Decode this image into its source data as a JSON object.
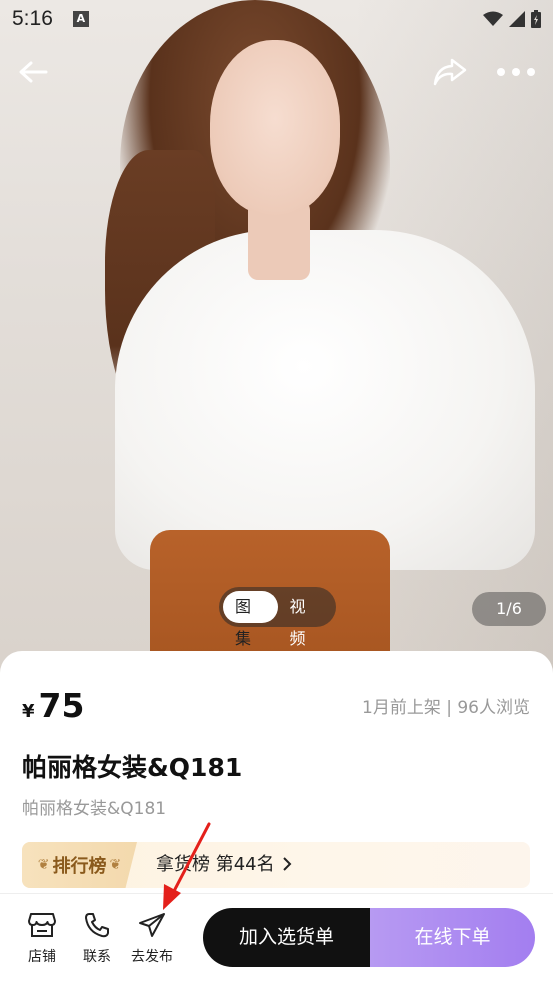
{
  "status_bar": {
    "time": "5:16",
    "notification_icon": "a-icon",
    "icons": [
      "wifi-icon",
      "signal-icon",
      "battery-icon"
    ]
  },
  "top_actions": {
    "back_icon": "back-arrow-icon",
    "share_icon": "share-icon",
    "more_icon": "more-icon"
  },
  "media": {
    "tabs": [
      {
        "label": "图集",
        "active": true
      },
      {
        "label": "视频",
        "active": false
      }
    ],
    "counter": "1/6"
  },
  "product": {
    "currency": "¥",
    "price": "75",
    "meta": "1月前上架 | 96人浏览",
    "title": "帕丽格女装&Q181",
    "subtitle": "帕丽格女装&Q181"
  },
  "ranking": {
    "badge": "排行榜",
    "text": "拿货榜 第44名",
    "chevron": "chevron-right-icon"
  },
  "bottom_bar": {
    "tools": [
      {
        "label": "店铺",
        "icon": "store-icon"
      },
      {
        "label": "联系",
        "icon": "phone-icon"
      },
      {
        "label": "去发布",
        "icon": "send-icon"
      }
    ],
    "add_to_list": "加入选货单",
    "order_online": "在线下单"
  },
  "colors": {
    "accent_purple": "#a37ef0",
    "black_button": "#111111",
    "rank_text": "#8a5a1c",
    "annotation": "#e4201b"
  }
}
